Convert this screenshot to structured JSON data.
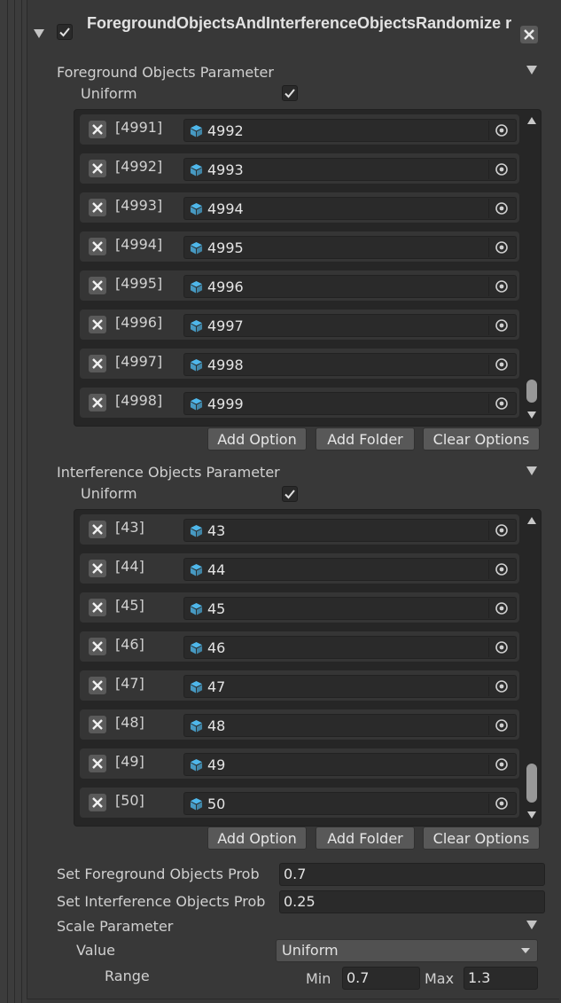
{
  "component": {
    "title": "ForegroundObjectsAndInterferenceObjectsRandomize r",
    "enabled": true
  },
  "foreground": {
    "label": "Foreground Objects Parameter",
    "uniform_label": "Uniform",
    "uniform_checked": true,
    "items": [
      {
        "index": "[4991]",
        "value": "4992"
      },
      {
        "index": "[4992]",
        "value": "4993"
      },
      {
        "index": "[4993]",
        "value": "4994"
      },
      {
        "index": "[4994]",
        "value": "4995"
      },
      {
        "index": "[4995]",
        "value": "4996"
      },
      {
        "index": "[4996]",
        "value": "4997"
      },
      {
        "index": "[4997]",
        "value": "4998"
      },
      {
        "index": "[4998]",
        "value": "4999"
      }
    ],
    "scroll_position": 0.97
  },
  "interference": {
    "label": "Interference Objects Parameter",
    "uniform_label": "Uniform",
    "uniform_checked": true,
    "items": [
      {
        "index": "[43]",
        "value": "43"
      },
      {
        "index": "[44]",
        "value": "44"
      },
      {
        "index": "[45]",
        "value": "45"
      },
      {
        "index": "[46]",
        "value": "46"
      },
      {
        "index": "[47]",
        "value": "47"
      },
      {
        "index": "[48]",
        "value": "48"
      },
      {
        "index": "[49]",
        "value": "49"
      },
      {
        "index": "[50]",
        "value": "50"
      }
    ],
    "scroll_position": 0.9
  },
  "buttons": {
    "add_option": "Add Option",
    "add_folder": "Add Folder",
    "clear_options": "Clear Options"
  },
  "probabilities": {
    "foreground_label": "Set Foreground Objects Prob",
    "foreground_value": "0.7",
    "interference_label": "Set Interference Objects Prob",
    "interference_value": "0.25"
  },
  "scale": {
    "label": "Scale Parameter",
    "value_label": "Value",
    "value_selected": "Uniform",
    "range_label": "Range",
    "min_label": "Min",
    "min_value": "0.7",
    "max_label": "Max",
    "max_value": "1.3"
  },
  "colors": {
    "background": "#383838",
    "cube_icon": "#4fb7ea",
    "button": "#585858",
    "field": "#2a2a2a"
  }
}
